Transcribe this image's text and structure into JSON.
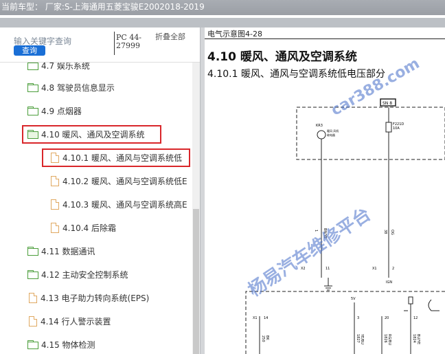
{
  "header": {
    "title": "当前车型：  厂家:S-上海通用五菱宝骏E2002018-2019"
  },
  "search": {
    "placeholder": "输入关键字查询",
    "button_label": "查询",
    "pc_label": "PC 44-27999",
    "collapse_label": "折叠全部"
  },
  "tree": {
    "items": [
      {
        "label": "4.7 娱乐系统",
        "type": "folder"
      },
      {
        "label": "4.8 驾驶员信息显示",
        "type": "folder"
      },
      {
        "label": "4.9 点烟器",
        "type": "folder"
      },
      {
        "label": "4.10 暖风、通风及空调系统",
        "type": "folder-open"
      },
      {
        "label": "4.10.1 暖风、通风与空调系统低",
        "type": "file"
      },
      {
        "label": "4.10.2 暖风、通风与空调系统低E",
        "type": "file"
      },
      {
        "label": "4.10.3 暖风、通风与空调系统高E",
        "type": "file"
      },
      {
        "label": "4.10.4 后除霜",
        "type": "file"
      },
      {
        "label": "4.11 数据通讯",
        "type": "folder"
      },
      {
        "label": "4.12 主动安全控制系统",
        "type": "folder"
      },
      {
        "label": "4.13 电子助力转向系统(EPS)",
        "type": "file"
      },
      {
        "label": "4.14 行人警示装置",
        "type": "file"
      },
      {
        "label": "4.15 物体检测",
        "type": "folder"
      }
    ]
  },
  "document": {
    "figure_label": "电气示意图4-28",
    "section_title": "4.10 暖风、通风及空调系统",
    "subsection_title": "4.10.1 暖风、通风与空调系统低电压部分"
  },
  "diagram": {
    "labels": {
      "fuse_box": "SN 8",
      "relay": "KR3",
      "relay_desc1": "暖风 风机",
      "relay_desc2": "继电器",
      "fuse": "F221D",
      "fuse_amp": "10A",
      "w1_num": "1",
      "w1_color": "BN/YE",
      "w2_num": "38",
      "w2_color": "OG",
      "x2": "X2",
      "x2_pin": "11",
      "x1": "X1",
      "x1_pin": "2",
      "ign": "IGN",
      "v5": "5V",
      "x1b": "X1",
      "pin14": "14",
      "pin3": "3",
      "pin20": "20",
      "pin12": "12",
      "w3_num": "250",
      "w3_color": "BK",
      "w4_num": "1827",
      "w4_color": "YE/BU",
      "w5_num": "1826",
      "w5_color": "RG/BU",
      "w6_num": "1824",
      "w6_color": "BU/YE"
    }
  },
  "watermarks": {
    "site": "car388.com",
    "platform": "杨易汽车维修平台"
  }
}
